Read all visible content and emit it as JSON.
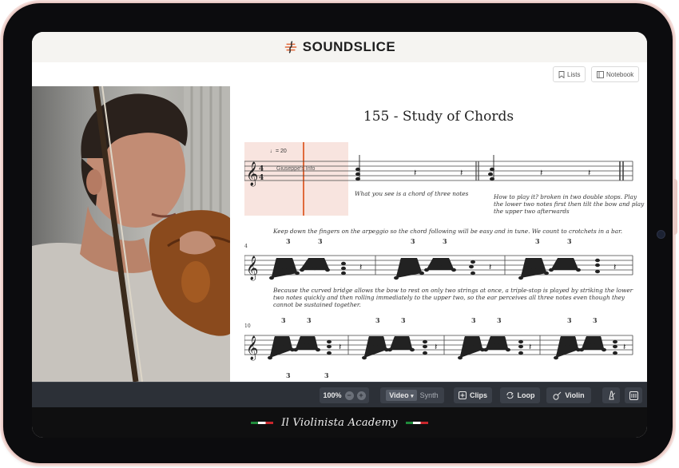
{
  "app": {
    "brand": "SOUNDSLICE",
    "brand_logo_icon": "soundslice-logo-icon"
  },
  "toolbar": {
    "lists_label": "Lists",
    "notebook_label": "Notebook"
  },
  "score": {
    "title": "155 - Study of Chords",
    "tempo": "♩= 20",
    "cursor_label": "Giuseppe's Info",
    "annotations": {
      "chord_note": "What you see is a chord of three notes",
      "how_to_play": "How to play it? broken in two double stops. Play the lower two notes first then tilt the bow and play the upper two afterwards",
      "keep_down": "Keep down the fingers on the arpeggio so the chord following will be easy and in tune. We count to crotchets in a bar.",
      "because": "Because the curved bridge allows the bow to rest on only two strings at once, a triple-stop is played by striking the lower two notes quickly and then rolling immediately to the upper two, so the ear perceives all three notes even though they cannot be sustained together."
    },
    "measure_numbers": [
      "4",
      "10"
    ],
    "triplet_mark": "3"
  },
  "controls": {
    "zoom": "100%",
    "zoom_out": "−",
    "zoom_in": "+",
    "video_label": "Video",
    "synth_label": "Synth",
    "clips_label": "Clips",
    "loop_label": "Loop",
    "violin_label": "Violin"
  },
  "footer": {
    "academy": "Il Violinista Academy"
  },
  "colors": {
    "cursor": "#e06a3b",
    "cursor_highlight": "#f8e4df",
    "controls_bg": "#2c3037",
    "footer_bg": "#0f0f10",
    "tablet_frame": "#e9c9c4"
  }
}
